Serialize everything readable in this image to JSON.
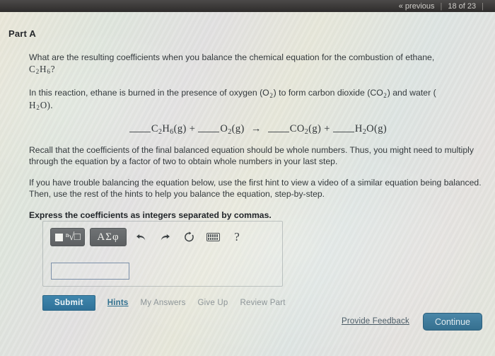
{
  "topbar": {
    "previous_label": "« previous",
    "page_indicator": "18 of 23",
    "separator": "|"
  },
  "part": {
    "title": "Part A"
  },
  "question": {
    "line1": "What are the resulting coefficients when you balance the chemical equation for the combustion of ethane,",
    "formula_ethane": "C",
    "formula_ethane_sub1": "2",
    "formula_ethane_mid": "H",
    "formula_ethane_sub2": "6",
    "formula_ethane_tail": "?",
    "para2_a": "In this reaction, ethane is burned in the presence of oxygen (O",
    "para2_sub1": "2",
    "para2_b": ") to form carbon dioxide (CO",
    "para2_sub2": "2",
    "para2_c": ") and water (",
    "para2_d": "H",
    "para2_sub3": "2",
    "para2_e": "O).",
    "recall": "Recall that the coefficients of the final balanced equation should be whole numbers. Thus, you might need to multiply through the equation by a factor of two to obtain whole numbers in your last step.",
    "hint_note": "If you have trouble balancing the equation below, use the first hint to view a video of a similar equation being balanced. Then, use the rest of the hints to help you balance the equation, step-by-step.",
    "instruction": "Express the coefficients as integers separated by commas."
  },
  "equation": {
    "r1_formula": "C",
    "r1_sub1": "2",
    "r1_mid": "H",
    "r1_sub2": "6",
    "r1_state": "(g)",
    "plus1": "+",
    "r2_formula": "O",
    "r2_sub": "2",
    "r2_state": "(g)",
    "arrow": "→",
    "p1_formula": "CO",
    "p1_sub": "2",
    "p1_state": "(g)",
    "plus2": "+",
    "p2_formula": "H",
    "p2_sub": "2",
    "p2_mid": "O",
    "p2_state": "(g)"
  },
  "toolbar": {
    "template_button_label": "√",
    "greek_button_label": "ΑΣφ",
    "undo_label": "undo",
    "redo_label": "redo",
    "reset_label": "reset",
    "keyboard_label": "keyboard",
    "help_label": "?"
  },
  "answer": {
    "value": "",
    "placeholder": ""
  },
  "actions": {
    "submit_label": "Submit",
    "hints_label": "Hints",
    "my_answers_label": "My Answers",
    "give_up_label": "Give Up",
    "review_part_label": "Review Part"
  },
  "footer": {
    "feedback_label": "Provide Feedback",
    "continue_label": "Continue"
  },
  "colors": {
    "submit_blue": "#2f7199",
    "continue_blue": "#35708f",
    "hints_link": "#31708f",
    "topbar_bg": "#3a3837",
    "page_bg": "#dcdcd4"
  }
}
